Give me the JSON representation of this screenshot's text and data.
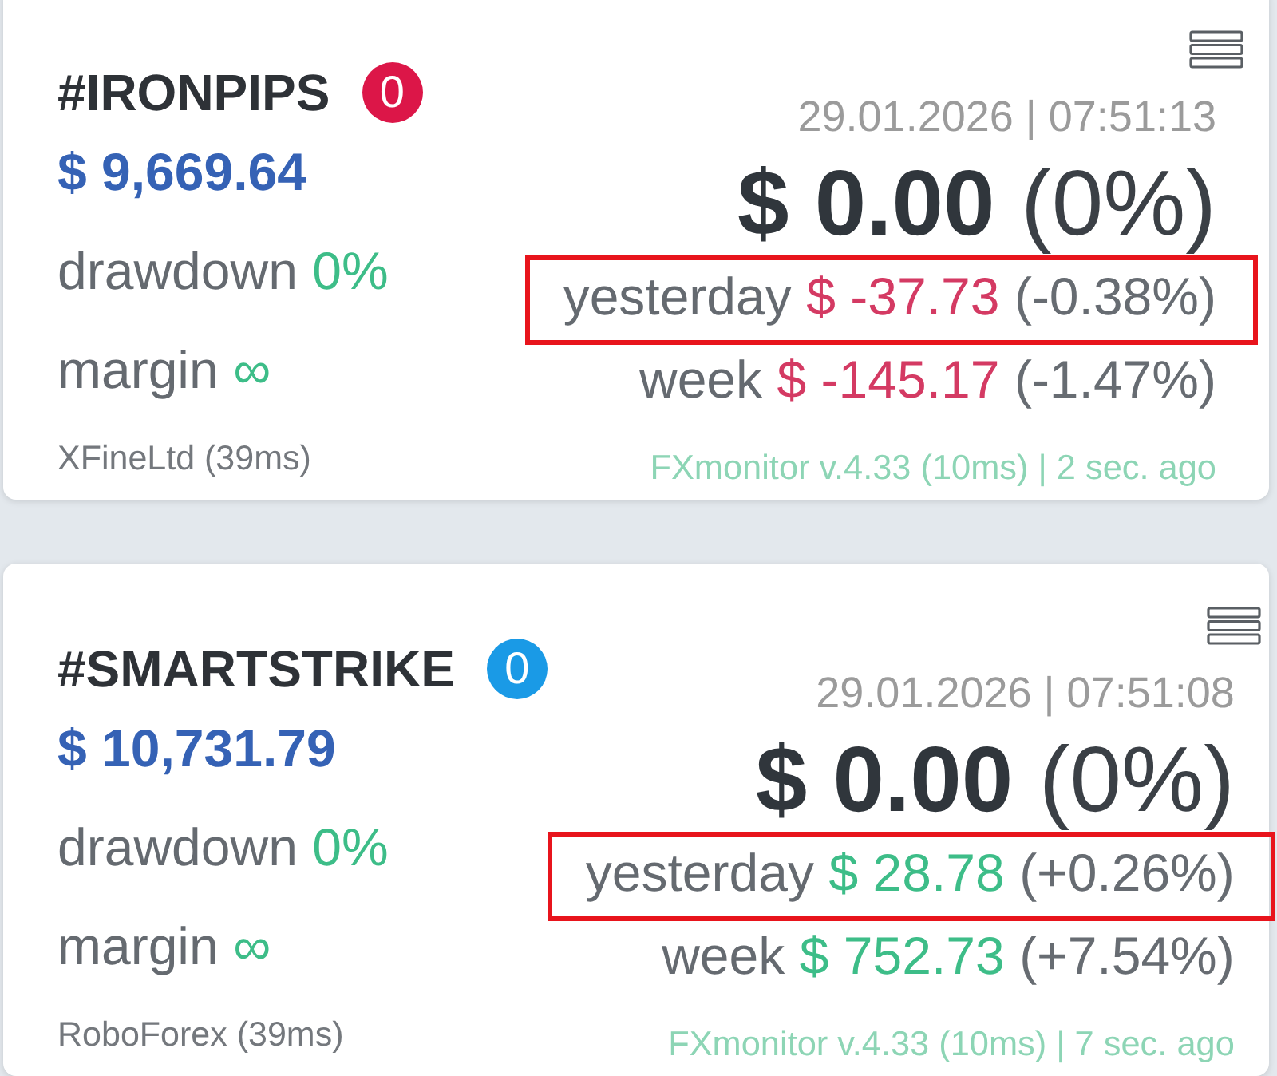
{
  "accounts": [
    {
      "name": "#IRONPIPS",
      "badge": {
        "text": "0",
        "color": "#dc1648"
      },
      "balance": "$ 9,669.64",
      "drawdown": {
        "label": "drawdown",
        "value": "0%"
      },
      "margin": {
        "label": "margin",
        "value": "∞"
      },
      "broker": "XFineLtd (39ms)",
      "timestamp": "29.01.2026 | 07:51:13",
      "profit": {
        "amount": "$ 0.00",
        "percent": "(0%)"
      },
      "stats": [
        {
          "label": "yesterday",
          "amount": "$ -37.73",
          "percent": "(-0.38%)",
          "negative": true,
          "highlighted": true
        },
        {
          "label": "week",
          "amount": "$ -145.17",
          "percent": "(-1.47%)",
          "negative": true,
          "highlighted": false
        }
      ],
      "status": "FXmonitor v.4.33 (10ms) | 2 sec. ago"
    },
    {
      "name": "#SMARTSTRIKE",
      "badge": {
        "text": "0",
        "color": "#1a9ae6"
      },
      "balance": "$ 10,731.79",
      "drawdown": {
        "label": "drawdown",
        "value": "0%"
      },
      "margin": {
        "label": "margin",
        "value": "∞"
      },
      "broker": "RoboForex (39ms)",
      "timestamp": "29.01.2026 | 07:51:08",
      "profit": {
        "amount": "$ 0.00",
        "percent": "(0%)"
      },
      "stats": [
        {
          "label": "yesterday",
          "amount": "$ 28.78",
          "percent": "(+0.26%)",
          "negative": false,
          "highlighted": true
        },
        {
          "label": "week",
          "amount": "$ 752.73",
          "percent": "(+7.54%)",
          "negative": false,
          "highlighted": false
        }
      ],
      "status": "FXmonitor v.4.33 (10ms) | 7 sec. ago"
    }
  ]
}
